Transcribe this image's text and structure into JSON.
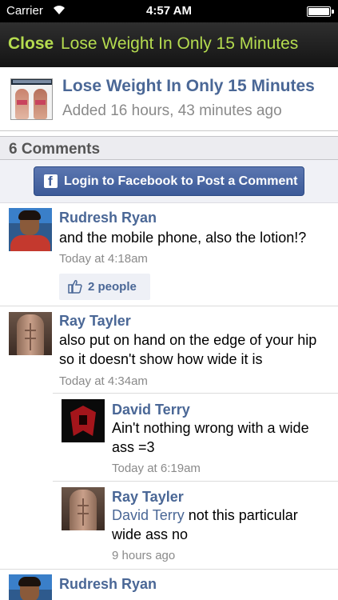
{
  "status_bar": {
    "carrier": "Carrier",
    "time": "4:57 AM",
    "battery_level": 1.0
  },
  "nav": {
    "close_label": "Close",
    "title": "Lose Weight In Only 15 Minutes"
  },
  "video": {
    "title": "Lose Weight In Only 15 Minutes",
    "added": "Added 16 hours, 43 minutes ago"
  },
  "comments_header": "6 Comments",
  "login_button": "Login to Facebook to Post a Comment",
  "comments": [
    {
      "author": "Rudresh Ryan",
      "avatar": "rudresh-avatar",
      "body": "and the mobile phone, also the lotion!?",
      "time": "Today at 4:18am",
      "likes": "2 people"
    },
    {
      "author": "Ray Tayler",
      "avatar": "ray-avatar",
      "body": "also put on hand on the edge of your hip so it doesn't show how wide it is",
      "time": "Today at 4:34am",
      "replies": [
        {
          "author": "David Terry",
          "avatar": "david-avatar",
          "body": "Ain't nothing wrong with a wide ass =3",
          "time": "Today at 6:19am"
        },
        {
          "author": "Ray Tayler",
          "avatar": "ray-avatar",
          "mention": "David Terry",
          "body": " not this particular wide ass no",
          "time": "9 hours ago"
        }
      ]
    },
    {
      "author": "Rudresh Ryan",
      "avatar": "rudresh-avatar"
    }
  ],
  "colors": {
    "accent_green": "#b5dc4f",
    "link_blue": "#4a6796",
    "facebook_blue": "#3c5a98"
  }
}
